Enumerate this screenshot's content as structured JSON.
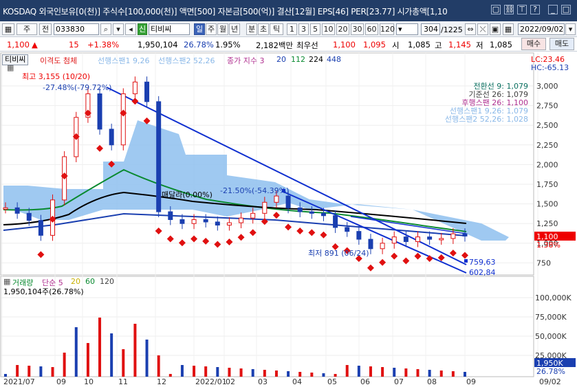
{
  "window": {
    "title": "KOSDAQ 외국인보유[0(천)] 주식수[100,000(천)] 액면[500] 자본금[500(억)] 결산[12월] EPS[46] PER[23.77] 시가총액[1,10"
  },
  "toolbar": {
    "market": "주",
    "prev": "전",
    "code": "033830",
    "name": "티비씨",
    "new_badge": "신",
    "period_tabs": [
      "일",
      "주",
      "월",
      "년",
      "분",
      "초",
      "틱"
    ],
    "selected_period": "일",
    "numbers": [
      "1",
      "3",
      "5",
      "10",
      "20",
      "30",
      "60",
      "120"
    ],
    "range": "304",
    "range_total": "/1225",
    "date": "2022/09/02"
  },
  "quote": {
    "price": "1,100",
    "change": "15",
    "change_pct": "+1.38%",
    "volume": "1,950,104",
    "turnover": "26.78%",
    "ratio": "1.95%",
    "amount": "2,182백만",
    "pref_label": "최우선",
    "bid1": "1,100",
    "bid2": "1,095",
    "open_label": "시",
    "open": "1,085",
    "high_label": "고",
    "high": "1,145",
    "low_label": "저",
    "low": "1,085",
    "buy_btn": "매수",
    "sell_btn": "매도"
  },
  "price_panel": {
    "tab": "티비씨",
    "legend": [
      {
        "text": "이격도 첨체",
        "color": "#e02020"
      },
      {
        "text": "선행스팬1 9,26",
        "color": "#8ab8e8"
      },
      {
        "text": "선행스팬2 52,26",
        "color": "#8ab8e8"
      },
      {
        "text": "종가 지수 3",
        "color": "#b03090"
      },
      {
        "text": "20",
        "color": "#1a3fb0"
      },
      {
        "text": "112",
        "color": "#0a8a30"
      },
      {
        "text": "224",
        "color": "#000000"
      },
      {
        "text": "448",
        "color": "#1a3fb0"
      }
    ],
    "lc": "LC:23.46",
    "hc": "HC:-65.13",
    "high_note": "최고 3,155 (10/20)",
    "high_pct": "-27.48%(-79.72%)",
    "low_note": "최저 891 (06/24)",
    "mid_label": "매달라(0.00%)",
    "mid_pct": "-21.50%(-54.39%)",
    "ichimoku": [
      {
        "text": "전환선 9: 1,079",
        "color": "#0a7060"
      },
      {
        "text": "기준선 26: 1,079",
        "color": "#404040"
      },
      {
        "text": "후행스팬 26: 1,100",
        "color": "#b03090"
      },
      {
        "text": "선행스팬1 9,26: 1,079",
        "color": "#8ab8e8"
      },
      {
        "text": "선행스팬2 52,26: 1,028",
        "color": "#8ab8e8"
      }
    ],
    "y_ticks": [
      "3,000",
      "2,750",
      "2,500",
      "2,250",
      "2,000",
      "1,750",
      "1,500",
      "1,250",
      "1,000",
      "750"
    ],
    "current_price": "1,100",
    "current_pct": "1.38%",
    "trend_value": "759,63",
    "trend_value2": "602,84"
  },
  "volume_panel": {
    "legend_title": "거래량",
    "legend_items": [
      {
        "text": "단순 5",
        "color": "#b03090"
      },
      {
        "text": "20",
        "color": "#c8b000"
      },
      {
        "text": "60",
        "color": "#0a8a30"
      },
      {
        "text": "120",
        "color": "#404040"
      }
    ],
    "volume_info": "1,950,104주(26.78%)",
    "y_ticks": [
      "100,000K",
      "75,000K",
      "50,000K",
      "25,000K"
    ],
    "current_vol": "1,950K",
    "current_pct": "26.78%"
  },
  "x_axis": [
    "2021/07",
    "09",
    "10",
    "11",
    "12",
    "2022/01",
    "02",
    "03",
    "04",
    "05",
    "06",
    "07",
    "08",
    "09",
    "09/02"
  ],
  "chart_data": {
    "type": "candlestick",
    "note": "daily candles approx.",
    "series": [
      {
        "name": "close",
        "values": [
          1450,
          1380,
          1290,
          1100,
          1550,
          2100,
          2600,
          2900,
          2450,
          2250,
          2900,
          3050,
          2800,
          1400,
          1300,
          1250,
          1300,
          1270,
          1230,
          1260,
          1320,
          1380,
          1520,
          1600,
          1450,
          1400,
          1380,
          1350,
          1200,
          1150,
          1050,
          930,
          1000,
          1080,
          1020,
          1080,
          1050,
          1060,
          1120,
          1090
        ]
      }
    ]
  }
}
